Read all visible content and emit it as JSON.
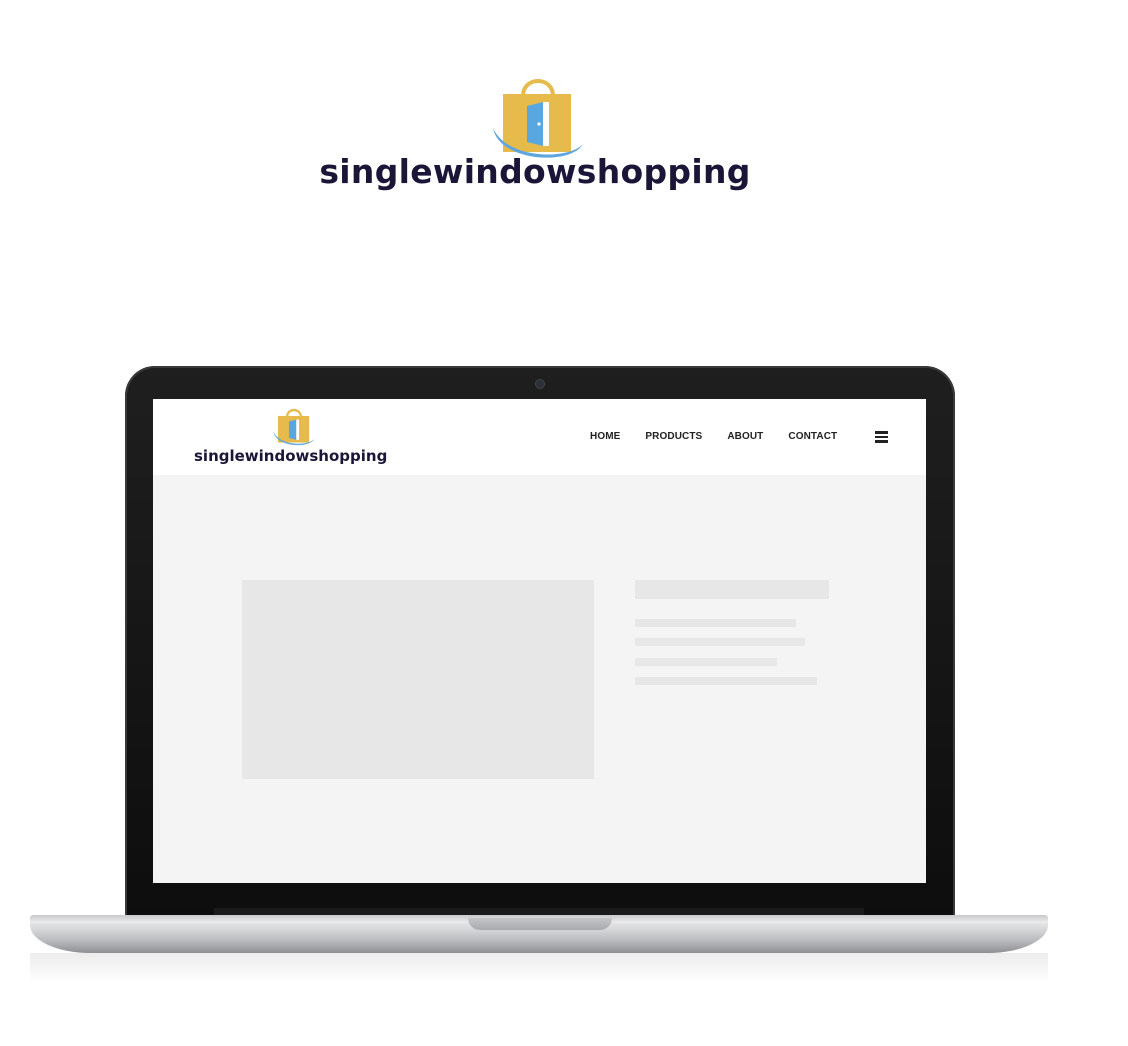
{
  "brand": {
    "name": "singlewindowshopping",
    "colors": {
      "bag": "#e6bb4c",
      "door": "#5aa7df",
      "swoosh": "#5ea6dd",
      "text": "#1b1638"
    }
  },
  "site": {
    "nav": [
      {
        "label": "HOME"
      },
      {
        "label": "PRODUCTS"
      },
      {
        "label": "ABOUT"
      },
      {
        "label": "CONTACT"
      }
    ],
    "menu_icon": "hamburger-menu-icon"
  },
  "placeholders": {
    "content_lines": 4
  }
}
